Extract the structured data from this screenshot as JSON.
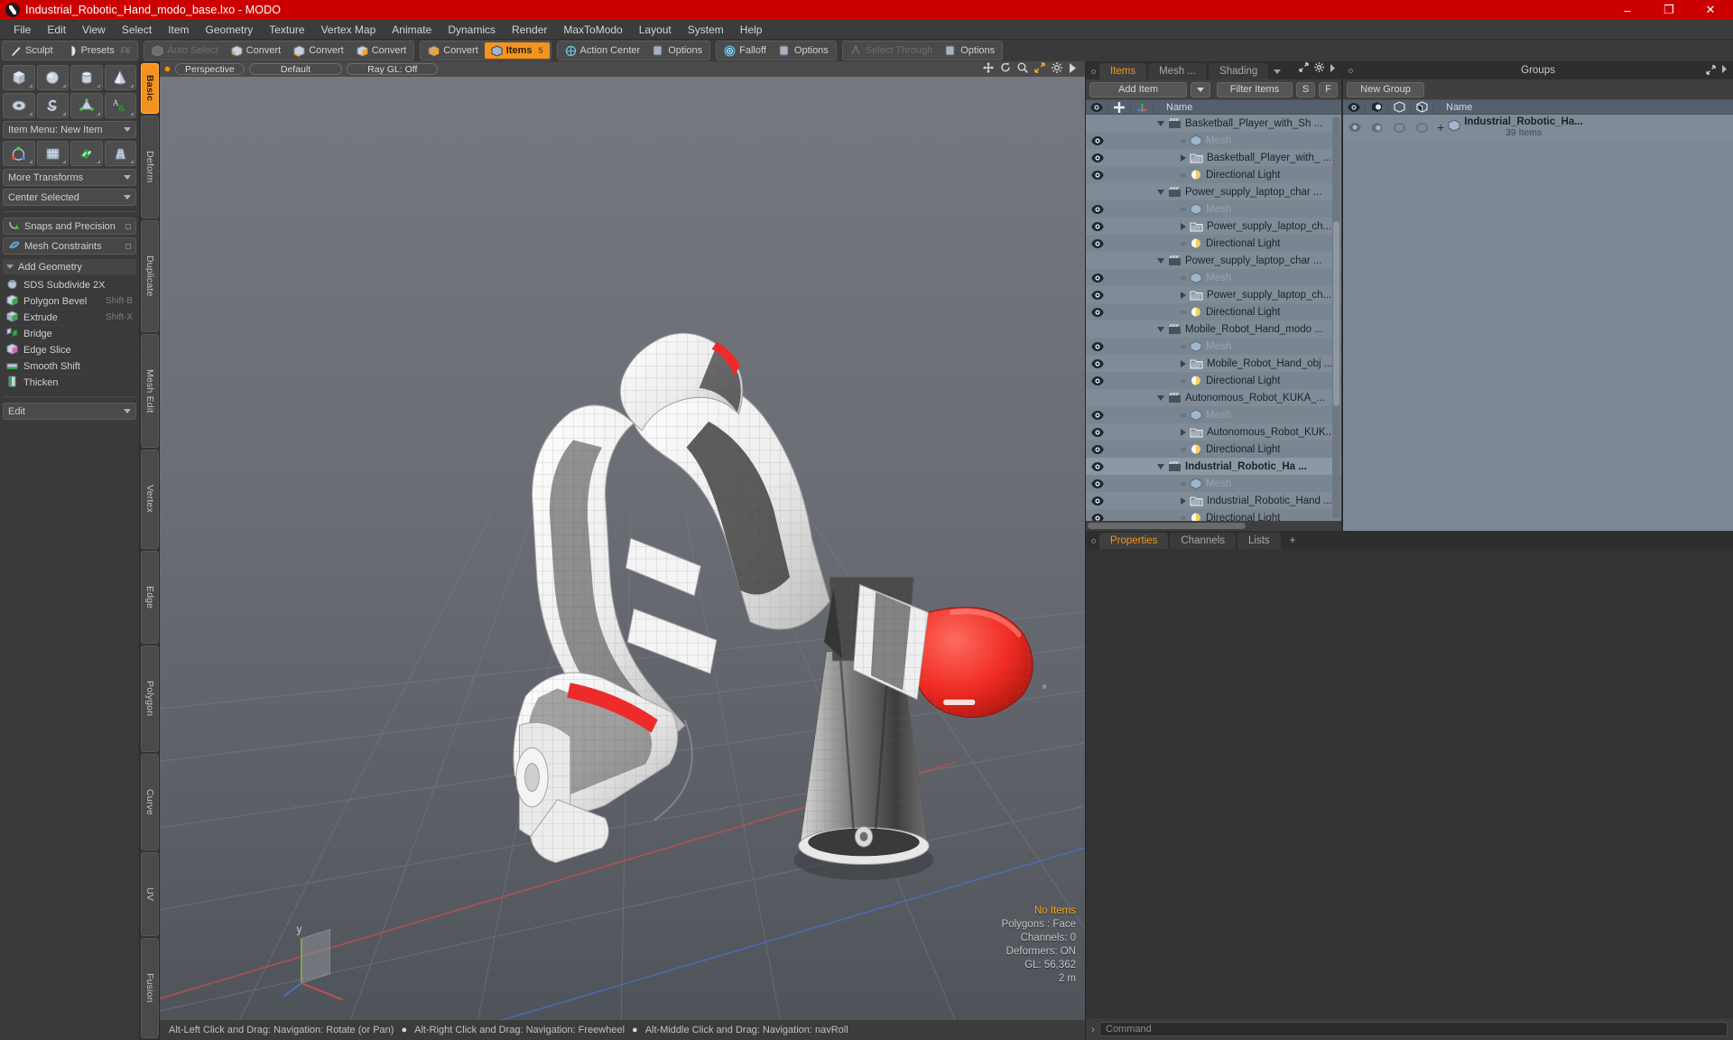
{
  "window": {
    "title": "Industrial_Robotic_Hand_modo_base.lxo - MODO",
    "minimize": "–",
    "maximize": "❐",
    "close": "✕"
  },
  "menubar": [
    "File",
    "Edit",
    "View",
    "Select",
    "Item",
    "Geometry",
    "Texture",
    "Vertex Map",
    "Animate",
    "Dynamics",
    "Render",
    "MaxToModo",
    "Layout",
    "System",
    "Help"
  ],
  "toolbar": {
    "groups": [
      {
        "items": [
          {
            "label": "Sculpt",
            "icon": "sculpt-icon",
            "state": "normal"
          },
          {
            "label": "Presets",
            "icon": "presets-icon",
            "state": "normal",
            "key": "F6"
          }
        ]
      },
      {
        "items": [
          {
            "label": "Auto Select",
            "icon": "auto-select-icon",
            "state": "dim"
          },
          {
            "label": "Convert",
            "icon": "convert-vertex-icon",
            "state": "normal"
          },
          {
            "label": "Convert",
            "icon": "convert-edge-icon",
            "state": "normal"
          },
          {
            "label": "Convert",
            "icon": "convert-polygon-icon",
            "state": "normal"
          }
        ]
      },
      {
        "items": [
          {
            "label": "Convert",
            "icon": "convert-material-icon",
            "state": "normal"
          },
          {
            "label": "Items",
            "icon": "items-icon",
            "state": "active",
            "key": "5"
          }
        ]
      },
      {
        "items": [
          {
            "label": "Action Center",
            "icon": "action-center-icon",
            "state": "normal"
          },
          {
            "label": "Options",
            "icon": "options-icon",
            "state": "normal"
          }
        ]
      },
      {
        "items": [
          {
            "label": "Falloff",
            "icon": "falloff-icon",
            "state": "normal"
          },
          {
            "label": "Options",
            "icon": "options-icon",
            "state": "normal"
          }
        ]
      },
      {
        "items": [
          {
            "label": "Select Through",
            "icon": "select-through-icon",
            "state": "dim"
          },
          {
            "label": "Options",
            "icon": "options-icon",
            "state": "normal"
          }
        ]
      }
    ]
  },
  "left_panel": {
    "shape_row_1": [
      "cube-icon",
      "sphere-icon",
      "cylinder-icon",
      "cone-icon"
    ],
    "shape_row_2": [
      "torus-icon",
      "spiral-icon",
      "prism-icon",
      "text-icon"
    ],
    "item_menu": "Item Menu: New Item",
    "tool_row": [
      "transform-icon",
      "mesh-grid-icon",
      "uv-checker-icon",
      "taper-icon"
    ],
    "more_transforms": "More Transforms",
    "center_selected": "Center Selected",
    "snaps": "Snaps and Precision",
    "mesh_constraints": "Mesh Constraints",
    "add_geometry_header": "Add Geometry",
    "commands": [
      {
        "label": "SDS Subdivide 2X",
        "shortcut": "",
        "icon": "sds-subdivide-icon"
      },
      {
        "label": "Polygon Bevel",
        "shortcut": "Shift-B",
        "icon": "polygon-bevel-icon"
      },
      {
        "label": "Extrude",
        "shortcut": "Shift-X",
        "icon": "extrude-icon"
      },
      {
        "label": "Bridge",
        "shortcut": "",
        "icon": "bridge-icon"
      },
      {
        "label": "Edge Slice",
        "shortcut": "",
        "icon": "edge-slice-icon"
      },
      {
        "label": "Smooth Shift",
        "shortcut": "",
        "icon": "smooth-shift-icon"
      },
      {
        "label": "Thicken",
        "shortcut": "",
        "icon": "thicken-icon"
      }
    ],
    "edit_dropdown": "Edit"
  },
  "vertical_tabs": [
    {
      "label": "Basic",
      "active": true
    },
    {
      "label": "Deform",
      "active": false
    },
    {
      "label": "Duplicate",
      "active": false
    },
    {
      "label": "Mesh Edit",
      "active": false
    },
    {
      "label": "Vertex",
      "active": false
    },
    {
      "label": "Edge",
      "active": false
    },
    {
      "label": "Polygon",
      "active": false
    },
    {
      "label": "Curve",
      "active": false
    },
    {
      "label": "UV",
      "active": false
    },
    {
      "label": "Fusion",
      "active": false
    }
  ],
  "viewport": {
    "header": {
      "view": "Perspective",
      "shading": "Default",
      "raygl": "Ray GL: Off"
    },
    "header_icons": [
      "move-icon",
      "rotate-icon",
      "zoom-icon",
      "fit-icon",
      "gear-icon",
      "play-icon"
    ],
    "stats": {
      "selection": "No Items",
      "polygons": "Polygons : Face",
      "channels": "Channels: 0",
      "deformers": "Deformers: ON",
      "gl": "GL: 56,362",
      "scale": "2 m"
    },
    "axis_labels": {
      "y": "y"
    },
    "colors": {
      "x_axis": "#c4504a",
      "z_axis": "#4a6fc4",
      "highlight": "#ee2b2b",
      "mesh": "#f2f2f2"
    }
  },
  "statusbar": {
    "hints": [
      "Alt-Left Click and Drag: Navigation: Rotate (or Pan)",
      "Alt-Right Click and Drag: Navigation: Freewheel",
      "Alt-Middle Click and Drag: Navigation: navRoll"
    ],
    "separator": "●"
  },
  "items_panel": {
    "tabs": [
      {
        "label": "Items",
        "active": true
      },
      {
        "label": "Mesh ...",
        "active": false
      },
      {
        "label": "Shading",
        "active": false
      }
    ],
    "add_item": "Add Item",
    "filter_items": "Filter Items",
    "btn_s": "S",
    "btn_f": "F",
    "columns": {
      "eye": "eye-icon",
      "lock": "lock-icon",
      "axis": "axis-icon",
      "name": "Name"
    },
    "rows": [
      {
        "name": "Basketball_Player_with_Sh ...",
        "type": "group",
        "indent": 0,
        "eye": false,
        "expander": "down",
        "icon": "scene-clapper-icon"
      },
      {
        "name": "Mesh",
        "type": "mesh",
        "indent": 1,
        "eye": true,
        "expander": "none",
        "icon": "mesh-icon",
        "dim": true
      },
      {
        "name": "Basketball_Player_with_ ...",
        "type": "mesh-item",
        "indent": 1,
        "eye": true,
        "expander": "right",
        "icon": "folder-icon"
      },
      {
        "name": "Directional Light",
        "type": "light",
        "indent": 1,
        "eye": true,
        "expander": "none",
        "icon": "light-icon"
      },
      {
        "name": "Power_supply_laptop_char ...",
        "type": "group",
        "indent": 0,
        "eye": false,
        "expander": "down",
        "icon": "scene-clapper-icon"
      },
      {
        "name": "Mesh",
        "type": "mesh",
        "indent": 1,
        "eye": true,
        "expander": "none",
        "icon": "mesh-icon",
        "dim": true
      },
      {
        "name": "Power_supply_laptop_ch...",
        "type": "mesh-item",
        "indent": 1,
        "eye": true,
        "expander": "right",
        "icon": "folder-icon"
      },
      {
        "name": "Directional Light",
        "type": "light",
        "indent": 1,
        "eye": true,
        "expander": "none",
        "icon": "light-icon"
      },
      {
        "name": "Power_supply_laptop_char ...",
        "type": "group",
        "indent": 0,
        "eye": false,
        "expander": "down",
        "icon": "scene-clapper-icon"
      },
      {
        "name": "Mesh",
        "type": "mesh",
        "indent": 1,
        "eye": true,
        "expander": "none",
        "icon": "mesh-icon",
        "dim": true
      },
      {
        "name": "Power_supply_laptop_ch...",
        "type": "mesh-item",
        "indent": 1,
        "eye": true,
        "expander": "right",
        "icon": "folder-icon"
      },
      {
        "name": "Directional Light",
        "type": "light",
        "indent": 1,
        "eye": true,
        "expander": "none",
        "icon": "light-icon"
      },
      {
        "name": "Mobile_Robot_Hand_modo ...",
        "type": "group",
        "indent": 0,
        "eye": false,
        "expander": "down",
        "icon": "scene-clapper-icon"
      },
      {
        "name": "Mesh",
        "type": "mesh",
        "indent": 1,
        "eye": true,
        "expander": "none",
        "icon": "mesh-icon",
        "dim": true
      },
      {
        "name": "Mobile_Robot_Hand_obj ...",
        "type": "mesh-item",
        "indent": 1,
        "eye": true,
        "expander": "right",
        "icon": "folder-icon"
      },
      {
        "name": "Directional Light",
        "type": "light",
        "indent": 1,
        "eye": true,
        "expander": "none",
        "icon": "light-icon"
      },
      {
        "name": "Autonomous_Robot_KUKA_...",
        "type": "group",
        "indent": 0,
        "eye": false,
        "expander": "down",
        "icon": "scene-clapper-icon"
      },
      {
        "name": "Mesh",
        "type": "mesh",
        "indent": 1,
        "eye": true,
        "expander": "none",
        "icon": "mesh-icon",
        "dim": true
      },
      {
        "name": "Autonomous_Robot_KUK...",
        "type": "mesh-item",
        "indent": 1,
        "eye": true,
        "expander": "right",
        "icon": "folder-icon"
      },
      {
        "name": "Directional Light",
        "type": "light",
        "indent": 1,
        "eye": true,
        "expander": "none",
        "icon": "light-icon"
      },
      {
        "name": "Industrial_Robotic_Ha ...",
        "type": "group",
        "indent": 0,
        "eye": true,
        "expander": "down",
        "icon": "scene-clapper-icon",
        "bold": true,
        "selected": true
      },
      {
        "name": "Mesh",
        "type": "mesh",
        "indent": 1,
        "eye": true,
        "expander": "none",
        "icon": "mesh-icon",
        "dim": true
      },
      {
        "name": "Industrial_Robotic_Hand ...",
        "type": "mesh-item",
        "indent": 1,
        "eye": true,
        "expander": "right",
        "icon": "folder-icon"
      },
      {
        "name": "Directional Light",
        "type": "light",
        "indent": 1,
        "eye": true,
        "expander": "none",
        "icon": "light-icon"
      }
    ]
  },
  "groups_panel": {
    "title": "Groups",
    "new_group": "New Group",
    "columns": {
      "eye": "eye-icon",
      "render": "render-icon",
      "shade1": "shade-icon",
      "shade2": "shade-outline-icon",
      "name": "Name"
    },
    "row": {
      "name": "Industrial_Robotic_Ha...",
      "count": "39 Items",
      "plus": "+",
      "icon": "mesh-icon"
    }
  },
  "properties_panel": {
    "tabs": [
      {
        "label": "Properties",
        "active": true
      },
      {
        "label": "Channels",
        "active": false
      },
      {
        "label": "Lists",
        "active": false
      }
    ],
    "add_tab": "+"
  },
  "command_bar": {
    "prompt": "›",
    "placeholder": "Command",
    "value": ""
  }
}
